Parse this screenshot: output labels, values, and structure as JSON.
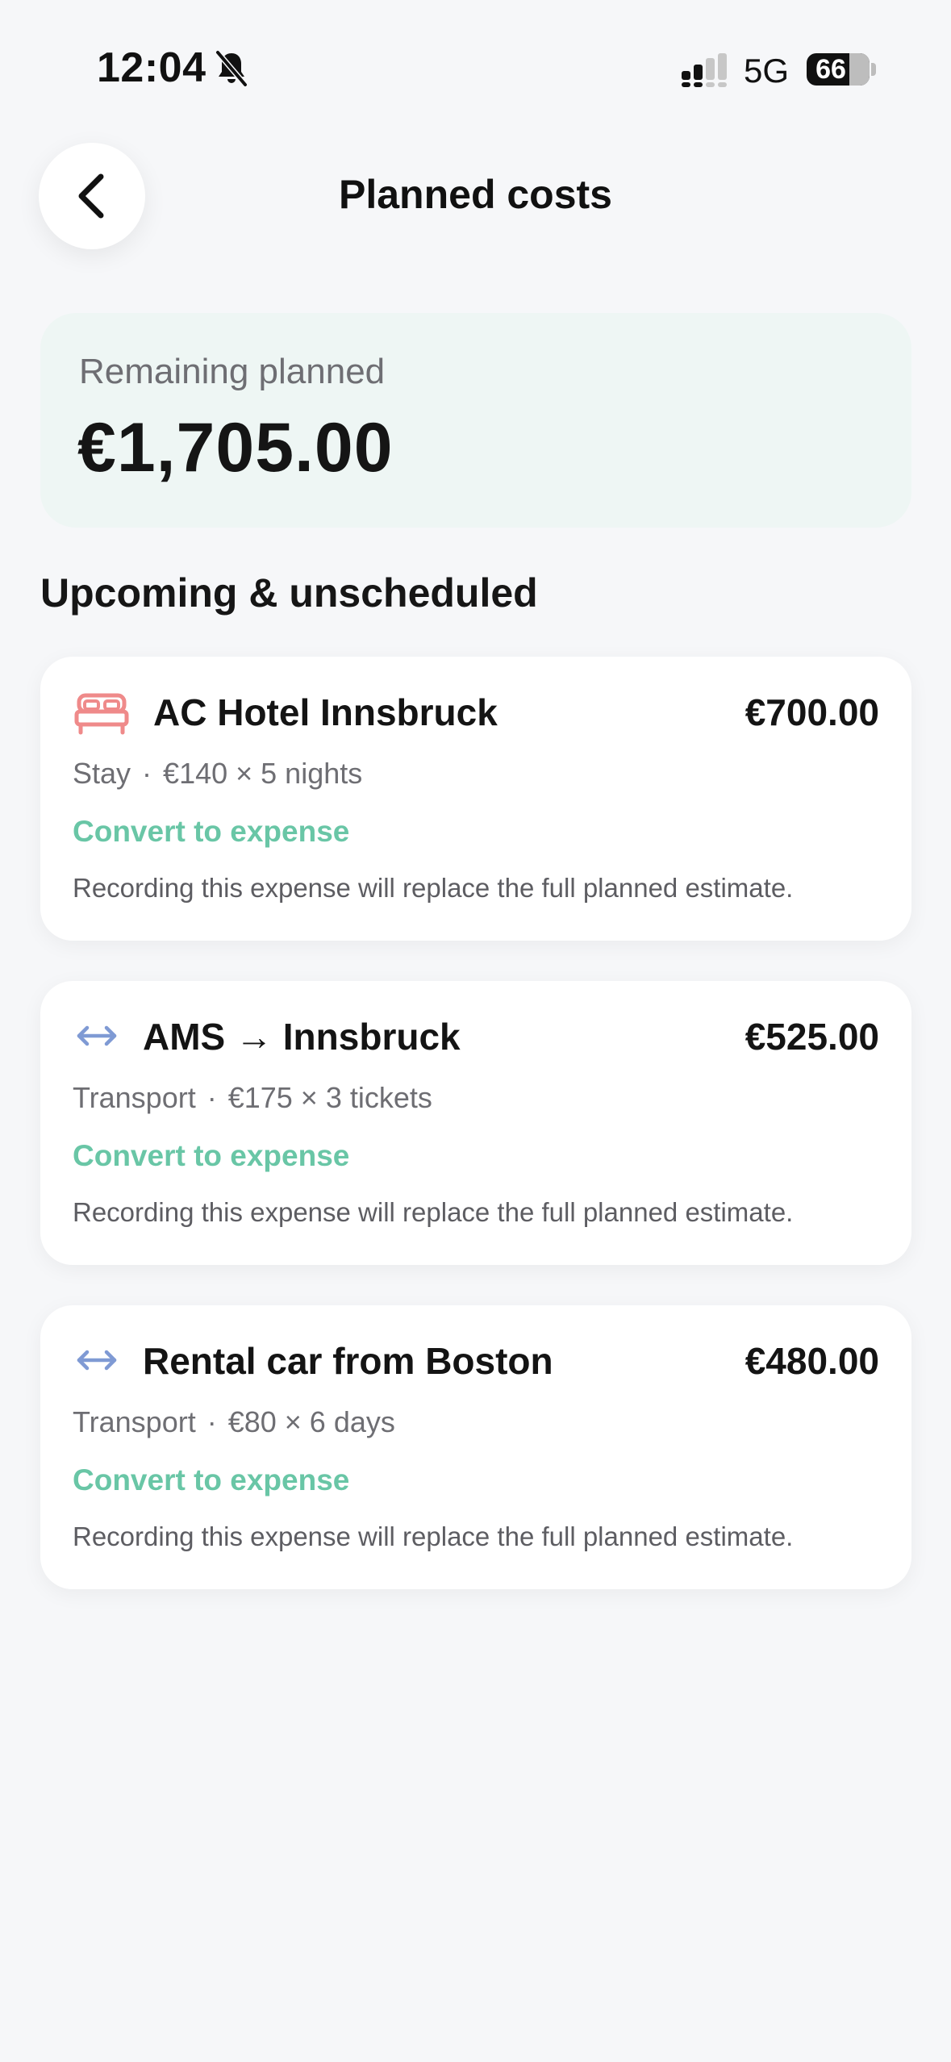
{
  "status_bar": {
    "time": "12:04",
    "network": "5G",
    "battery": "66"
  },
  "header": {
    "title": "Planned costs"
  },
  "summary": {
    "label": "Remaining planned",
    "amount": "€1,705.00"
  },
  "section": {
    "title": "Upcoming & unscheduled"
  },
  "colors": {
    "accent": "#69c6a6",
    "stay_icon": "#ef8a8a",
    "transport_icon": "#7f9ad4",
    "summary_bg": "#eef6f4"
  },
  "cards": [
    {
      "icon": "bed-icon",
      "title": "AC Hotel Innsbruck",
      "amount": "€700.00",
      "category": "Stay",
      "detail": "€140 × 5 nights",
      "action": "Convert to expense",
      "note": "Recording this expense will replace the full planned estimate."
    },
    {
      "icon": "transport-arrows-icon",
      "title": "AMS → Innsbruck",
      "amount": "€525.00",
      "category": "Transport",
      "detail": "€175 × 3 tickets",
      "action": "Convert to expense",
      "note": "Recording this expense will replace the full planned estimate."
    },
    {
      "icon": "transport-arrows-icon",
      "title": "Rental car from Boston",
      "amount": "€480.00",
      "category": "Transport",
      "detail": "€80 × 6 days",
      "action": "Convert to expense",
      "note": "Recording this expense will replace the full planned estimate."
    }
  ]
}
